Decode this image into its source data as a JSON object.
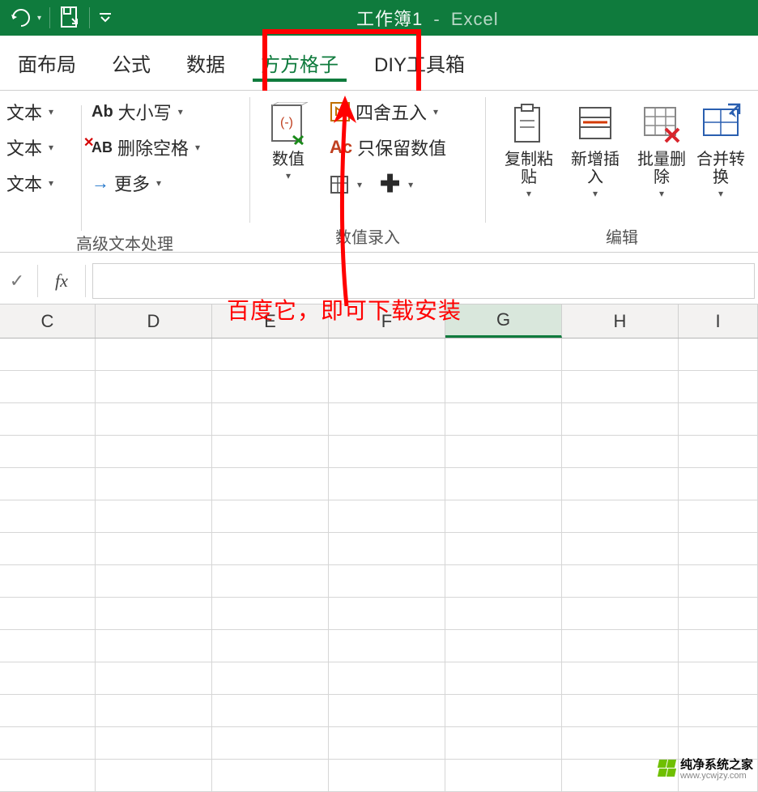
{
  "title": {
    "workbook": "工作簿1",
    "app": "Excel",
    "sep": " - "
  },
  "tabs": {
    "layout": "面布局",
    "formula": "公式",
    "data": "数据",
    "ffgz": "方方格子",
    "diy": "DIY工具箱"
  },
  "ribbon": {
    "text_group": {
      "r1": "文本",
      "r2": "文本",
      "r3": "文本",
      "case": "大小写",
      "trim": "删除空格",
      "more": "更多",
      "label": "高级文本处理"
    },
    "num_group": {
      "numeric": "数值",
      "round": "四舍五入",
      "onlynum": "只保留数值",
      "label": "数值录入"
    },
    "edit_group": {
      "copy": "复制粘贴",
      "insert": "新增插入",
      "delete": "批量删除",
      "merge": "合并转换",
      "label": "编辑"
    }
  },
  "formula_bar": {
    "fx": "fx",
    "check": "✓"
  },
  "columns": [
    "C",
    "D",
    "E",
    "F",
    "G",
    "H",
    "I"
  ],
  "active_column": "G",
  "annotation": "百度它，即可下载安装",
  "watermark": {
    "name": "纯净系统之家",
    "url": "www.ycwjzy.com"
  }
}
